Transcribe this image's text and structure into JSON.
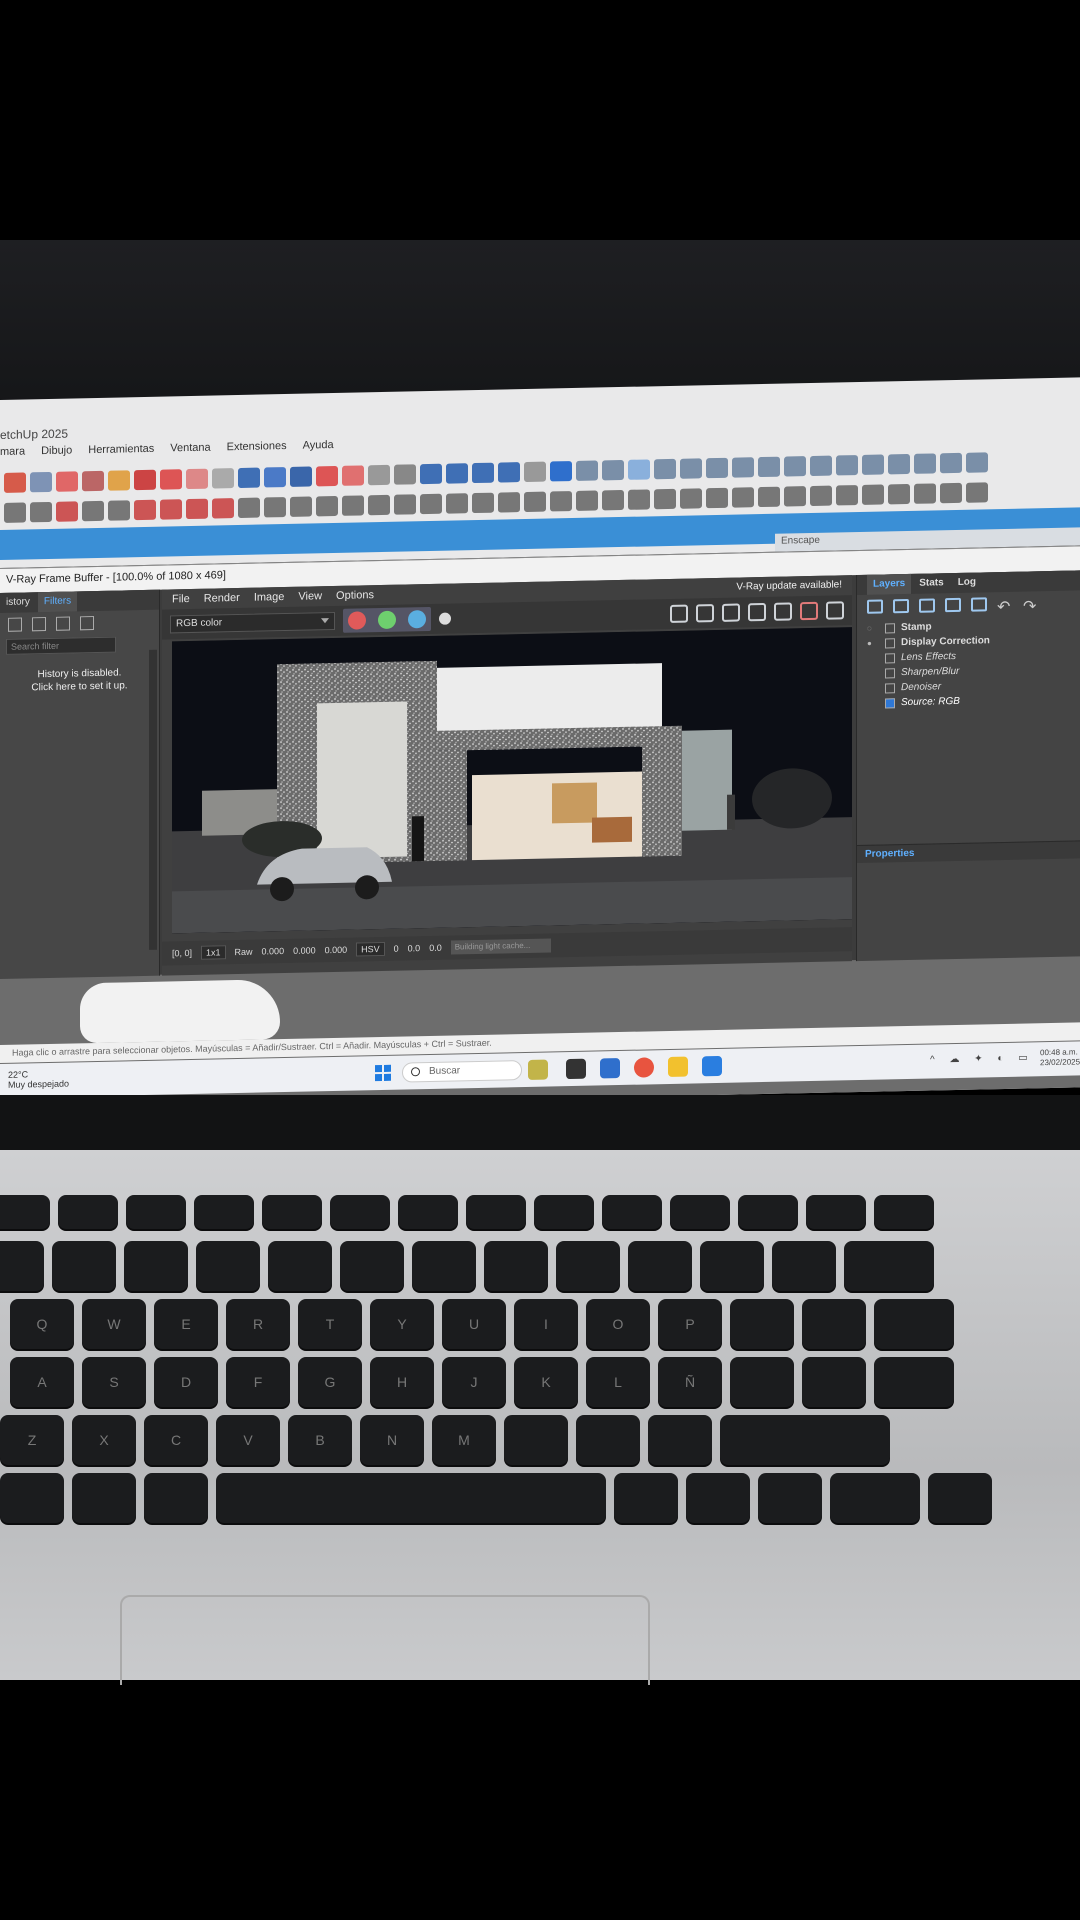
{
  "sketchup": {
    "title": "etchUp 2025",
    "menus": [
      "mara",
      "Dibujo",
      "Herramientas",
      "Ventana",
      "Extensiones",
      "Ayuda"
    ],
    "tray_label": "Enscape",
    "status": "Haga clic o arrastre para seleccionar objetos. Mayúsculas = Añadir/Sustraer. Ctrl = Añadir. Mayúsculas + Ctrl = Sustraer."
  },
  "taskbar": {
    "weather_temp": "22°C",
    "weather_desc": "Muy despejado",
    "search_placeholder": "Buscar",
    "clock_time": "00:48 a.m.",
    "clock_date": "23/02/2025"
  },
  "vfb": {
    "title": "V-Ray Frame Buffer - [100.0% of 1080 x 469]",
    "left_tabs": [
      "istory",
      "Filters"
    ],
    "search_placeholder": "Search filter",
    "history_msg_line1": "History is disabled.",
    "history_msg_line2": "Click here to set it up.",
    "menu": [
      "File",
      "Render",
      "Image",
      "View",
      "Options"
    ],
    "update_notice": "V-Ray update available!",
    "channel": "RGB color",
    "channel_dots": {
      "red": "#e05a5a",
      "green": "#6ecf6e",
      "blue": "#5aaee0"
    },
    "bottom": {
      "coords": "[0, 0]",
      "zoom": "1x1",
      "raw_label": "Raw",
      "r": "0.000",
      "g": "0.000",
      "b": "0.000",
      "space": "HSV",
      "h": "0",
      "s": "0.0",
      "v": "0.0",
      "progress": "Building light cache..."
    },
    "right_tabs": [
      "Layers",
      "Stats",
      "Log"
    ],
    "layers": [
      {
        "label": "Stamp",
        "kind": "top"
      },
      {
        "label": "Display Correction",
        "kind": "top"
      },
      {
        "label": "Lens Effects",
        "kind": "child"
      },
      {
        "label": "Sharpen/Blur",
        "kind": "child"
      },
      {
        "label": "Denoiser",
        "kind": "child"
      },
      {
        "label": "Source: RGB",
        "kind": "child"
      }
    ],
    "properties_label": "Properties"
  },
  "keyboard": {
    "row_q": [
      "Q",
      "W",
      "E",
      "R",
      "T",
      "Y",
      "U",
      "I",
      "O",
      "P"
    ],
    "row_a": [
      "A",
      "S",
      "D",
      "F",
      "G",
      "H",
      "J",
      "K",
      "L",
      "Ñ"
    ],
    "row_z": [
      "Z",
      "X",
      "C",
      "V",
      "B",
      "N",
      "M"
    ]
  }
}
